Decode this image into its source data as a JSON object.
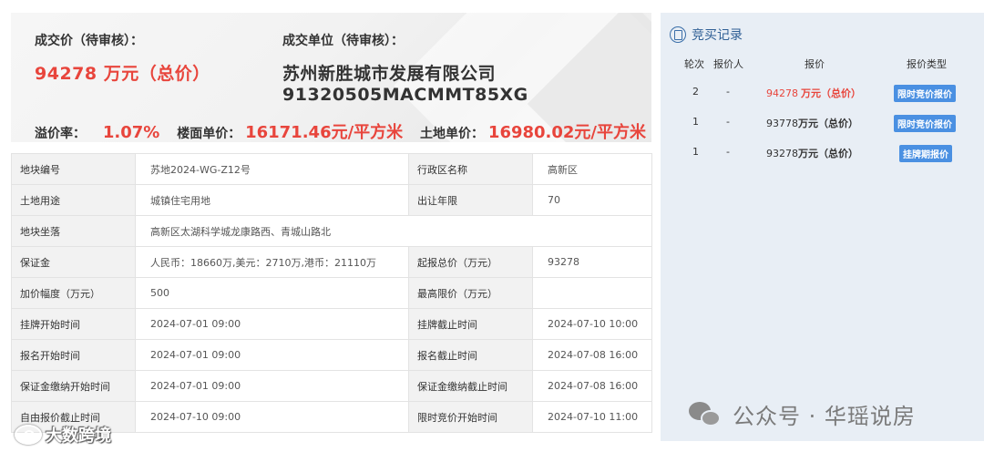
{
  "summary": {
    "price_label": "成交价（待审核）：",
    "price_value": "94278 万元（总价）",
    "winner_label": "成交单位（待审核）：",
    "winner_name": "苏州新胜城市发展有限公司",
    "winner_code": "91320505MACMMT85XG",
    "premium_label": "溢价率：",
    "premium_value": "1.07%",
    "floor_price_label": "楼面单价：",
    "floor_price_value": "16171.46元/平方米",
    "land_price_label": "土地单价：",
    "land_price_value": "16980.02元/平方米"
  },
  "info": {
    "r1": {
      "k1": "地块编号",
      "v1": "苏地2024-WG-Z12号",
      "k2": "行政区名称",
      "v2": "高新区"
    },
    "r2": {
      "k1": "土地用途",
      "v1": "城镇住宅用地",
      "k2": "出让年限",
      "v2": "70"
    },
    "r3": {
      "k1": "地块坐落",
      "v1": "高新区太湖科学城龙康路西、青城山路北"
    },
    "r4": {
      "k1": "保证金",
      "v1": "人民币：18660万,美元：2710万,港币：21110万",
      "k2": "起报总价（万元）",
      "v2": "93278"
    },
    "r5": {
      "k1": "加价幅度（万元）",
      "v1": "500",
      "k2": "最高限价（万元）",
      "v2": ""
    },
    "r6": {
      "k1": "挂牌开始时间",
      "v1": "2024-07-01 09:00",
      "k2": "挂牌截止时间",
      "v2": "2024-07-10 10:00"
    },
    "r7": {
      "k1": "报名开始时间",
      "v1": "2024-07-01 09:00",
      "k2": "报名截止时间",
      "v2": "2024-07-08 16:00"
    },
    "r8": {
      "k1": "保证金缴纳开始时间",
      "v1": "2024-07-01 09:00",
      "k2": "保证金缴纳截止时间",
      "v2": "2024-07-08 16:00"
    },
    "r9": {
      "k1": "自由报价截止时间",
      "v1": "2024-07-10 09:00",
      "k2": "限时竞价开始时间",
      "v2": "2024-07-10 11:00"
    }
  },
  "bids": {
    "title": "竞买记录",
    "columns": {
      "round": "轮次",
      "bidder": "报价人",
      "price": "报价",
      "type": "报价类型"
    },
    "rows": [
      {
        "round": "2",
        "bidder": "-",
        "price": "94278",
        "unit": "万元（总价）",
        "type": "限时竞价报价"
      },
      {
        "round": "1",
        "bidder": "-",
        "price": "93778",
        "unit": "万元（总价）",
        "type": "限时竞价报价"
      },
      {
        "round": "1",
        "bidder": "-",
        "price": "93278",
        "unit": "万元（总价）",
        "type": "挂牌期报价"
      }
    ]
  },
  "watermarks": {
    "right": "公众号 · 华瑶说房",
    "left": "大数跨境"
  },
  "colors": {
    "accent_red": "#e8453c",
    "panel_bg": "#e8eef5",
    "tag_blue": "#4a90e2",
    "title_blue": "#2f5f95"
  }
}
